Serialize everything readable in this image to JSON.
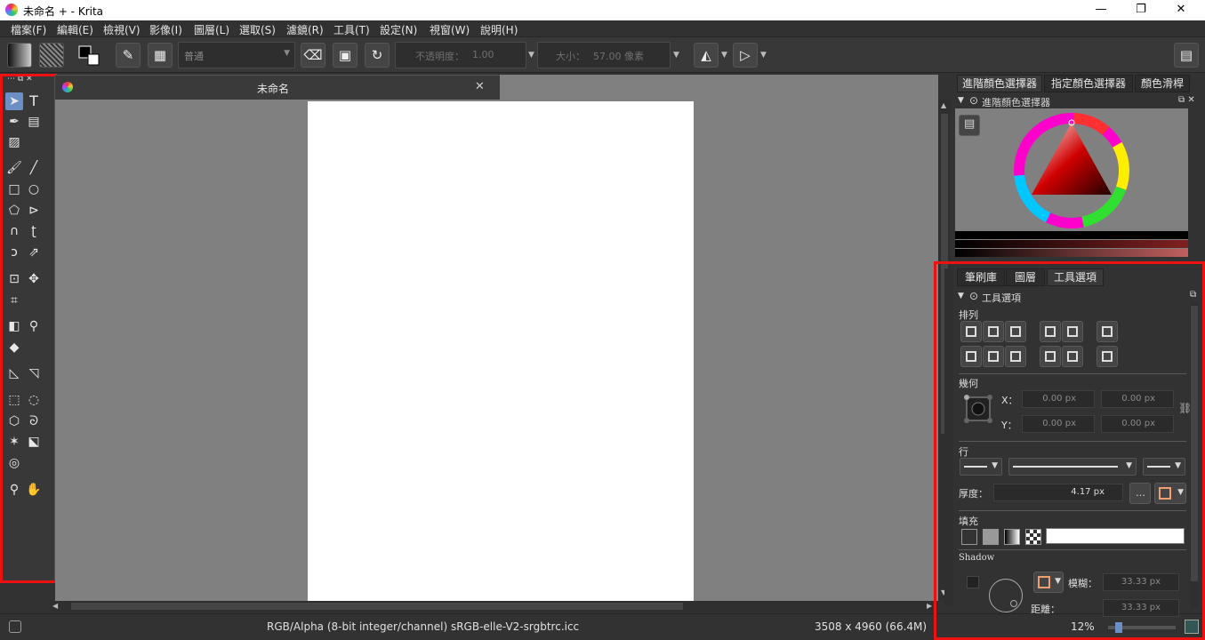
{
  "window": {
    "title": "未命名 + - Krita",
    "minimize_glyph": "—",
    "maximize_glyph": "❐",
    "close_glyph": "✕"
  },
  "menu": [
    "檔案(F)",
    "編輯(E)",
    "檢視(V)",
    "影像(I)",
    "圖層(L)",
    "選取(S)",
    "濾鏡(R)",
    "工具(T)",
    "設定(N)",
    "視窗(W)",
    "說明(H)"
  ],
  "toolbar": {
    "blend_mode": "普通",
    "opacity_label": "不透明度：",
    "opacity_value": "1.00",
    "size_label": "大小：",
    "size_value": "57.00 像素"
  },
  "document": {
    "tab_title": "未命名"
  },
  "status": {
    "color_space": "RGB/Alpha (8-bit integer/channel)  sRGB-elle-V2-srgbtrc.icc",
    "dimensions": "3508 x 4960 (66.4M)",
    "zoom": "12%"
  },
  "docker_top": {
    "tabs": [
      "進階顏色選擇器",
      "指定顏色選擇器",
      "顏色滑桿"
    ],
    "active_tab_index": 0,
    "panel_title": "進階顏色選擇器"
  },
  "docker_bottom": {
    "tabs": [
      "筆刷庫",
      "圖層",
      "工具選項"
    ],
    "active_tab_index": 2,
    "panel_title": "工具選項",
    "arrange_label": "排列",
    "geometry_label": "幾何",
    "x_label": "X：",
    "y_label": "Y：",
    "x_value": "0.00 px",
    "x2_value": "0.00 px",
    "y_value": "0.00 px",
    "y2_value": "0.00 px",
    "line_label": "行",
    "thickness_label": "厚度：",
    "thickness_value": "4.17 px",
    "fill_label": "填充",
    "shadow_label": "Shadow",
    "blur_label": "模糊：",
    "blur_value": "33.33 px",
    "distance_label": "距離：",
    "distance_value": "33.33 px"
  },
  "colors": {
    "highlight_red": "#ee1111",
    "selected_tool": "#6b8fc4",
    "canvas_bg": "#808080"
  }
}
